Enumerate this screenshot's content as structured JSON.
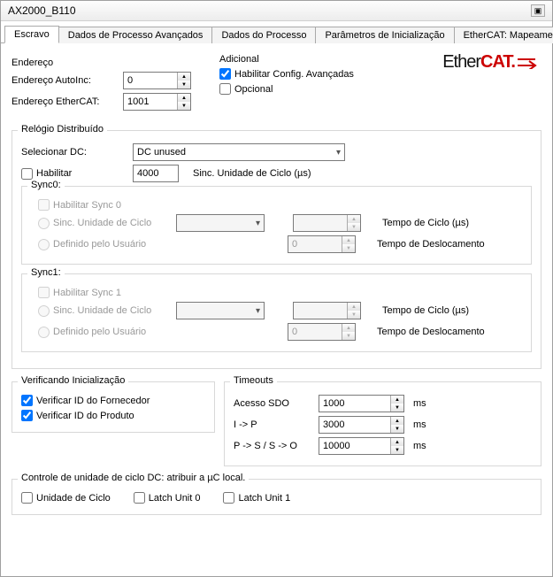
{
  "window": {
    "title": "AX2000_B110"
  },
  "tabs": {
    "items": [
      "Escravo",
      "Dados de Processo Avançados",
      "Dados do Processo",
      "Parâmetros de Inicialização",
      "EtherCAT: Mapeamento d"
    ],
    "active": 0
  },
  "endereco": {
    "legend": "Endereço",
    "autoinc_label": "Endereço AutoInc:",
    "autoinc_value": "0",
    "ethercat_label": "Endereço EtherCAT:",
    "ethercat_value": "1001"
  },
  "adicional": {
    "legend": "Adicional",
    "adv_label": "Habilitar Config. Avançadas",
    "adv_checked": true,
    "optional_label": "Opcional",
    "optional_checked": false,
    "logo_ether": "Ether",
    "logo_cat": "CAT."
  },
  "dc": {
    "legend": "Relógio Distribuído",
    "select_label": "Selecionar DC:",
    "select_value": "DC unused",
    "enable_label": "Habilitar",
    "enable_checked": false,
    "cycle_value": "4000",
    "cycle_unit": "Sinc. Unidade de Ciclo (µs)"
  },
  "sync0": {
    "legend": "Sync0:",
    "enable_label": "Habilitar Sync 0",
    "opt_cycle": "Sinc. Unidade de Ciclo",
    "opt_user": "Definido pelo Usuário",
    "cycle_time_label": "Tempo de Ciclo (µs)",
    "shift_time_label": "Tempo de Deslocamento",
    "cycle_val": "",
    "user_val": "0"
  },
  "sync1": {
    "legend": "Sync1:",
    "enable_label": "Habilitar Sync 1",
    "opt_cycle": "Sinc. Unidade de Ciclo",
    "opt_user": "Definido pelo Usuário",
    "cycle_time_label": "Tempo de Ciclo (µs)",
    "shift_time_label": "Tempo de Deslocamento",
    "cycle_val": "",
    "user_val": "0"
  },
  "init": {
    "legend": "Verificando Inicialização",
    "vendor_label": "Verificar ID do Fornecedor",
    "vendor_checked": true,
    "product_label": "Verificar ID do Produto",
    "product_checked": true
  },
  "timeouts": {
    "legend": "Timeouts",
    "sdo_label": "Acesso SDO",
    "sdo_value": "1000",
    "ip_label": "I -> P",
    "ip_value": "3000",
    "psso_label": "P -> S / S -> O",
    "psso_value": "10000",
    "unit": "ms"
  },
  "dc_ctrl": {
    "legend": "Controle de unidade de ciclo DC: atribuir a µC local.",
    "cycle_label": "Unidade de Ciclo",
    "latch0_label": "Latch Unit 0",
    "latch1_label": "Latch Unit 1"
  }
}
